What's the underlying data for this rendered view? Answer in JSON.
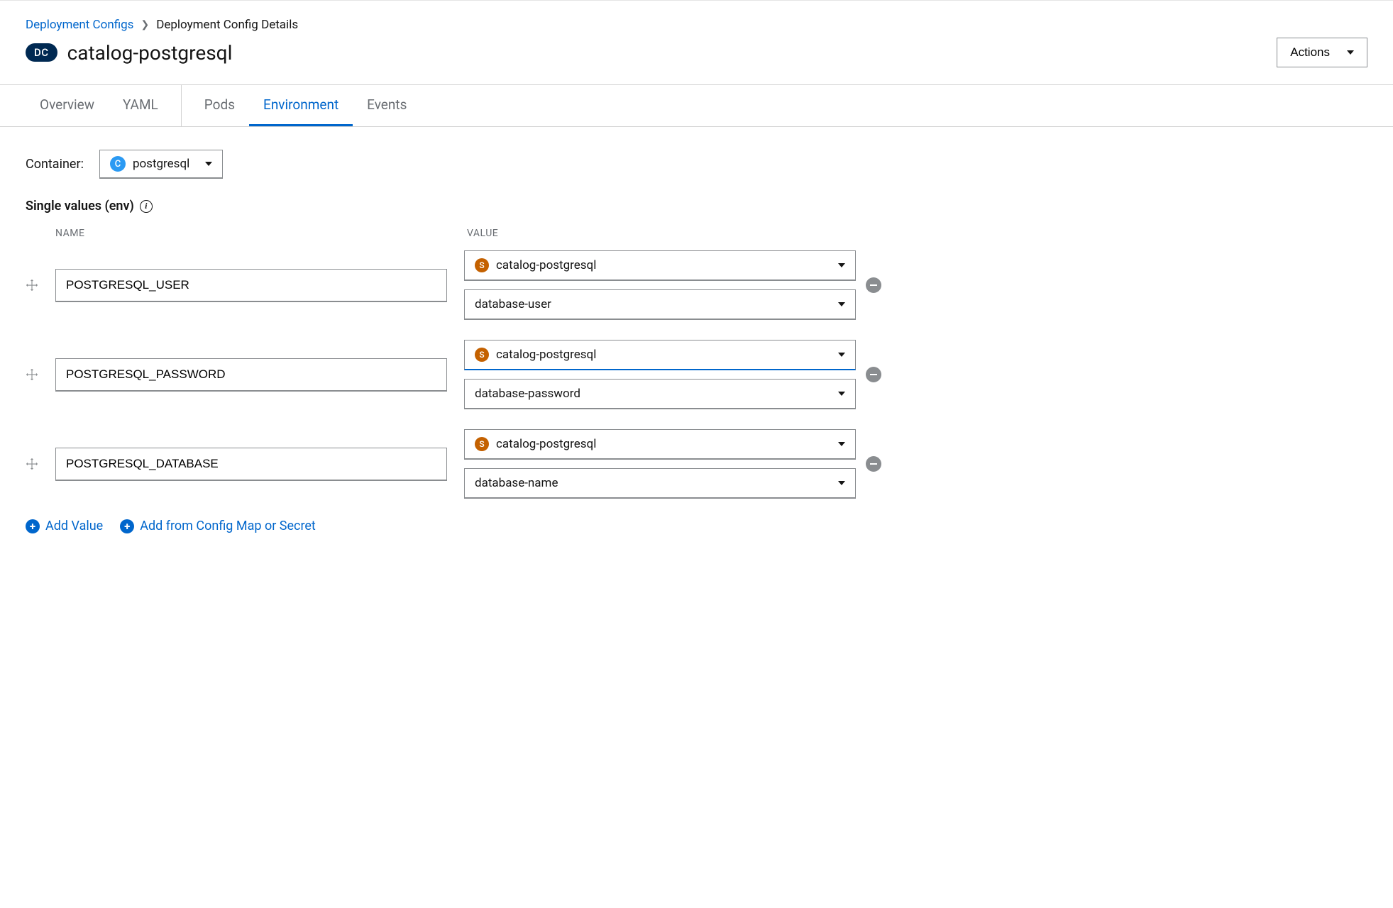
{
  "breadcrumb": {
    "link": "Deployment Configs",
    "current": "Deployment Config Details"
  },
  "badge": "DC",
  "title": "catalog-postgresql",
  "actions_label": "Actions",
  "tabs": {
    "overview": "Overview",
    "yaml": "YAML",
    "pods": "Pods",
    "environment": "Environment",
    "events": "Events"
  },
  "container": {
    "label": "Container:",
    "badge": "C",
    "name": "postgresql"
  },
  "section": {
    "title": "Single values (env)"
  },
  "columns": {
    "name": "NAME",
    "value": "VALUE"
  },
  "env_rows": [
    {
      "name": "POSTGRESQL_USER",
      "secret_badge": "S",
      "secret": "catalog-postgresql",
      "key": "database-user",
      "focused": false
    },
    {
      "name": "POSTGRESQL_PASSWORD",
      "secret_badge": "S",
      "secret": "catalog-postgresql",
      "key": "database-password",
      "focused": true
    },
    {
      "name": "POSTGRESQL_DATABASE",
      "secret_badge": "S",
      "secret": "catalog-postgresql",
      "key": "database-name",
      "focused": false
    }
  ],
  "add": {
    "value": "Add Value",
    "configmap": "Add from Config Map or Secret"
  }
}
